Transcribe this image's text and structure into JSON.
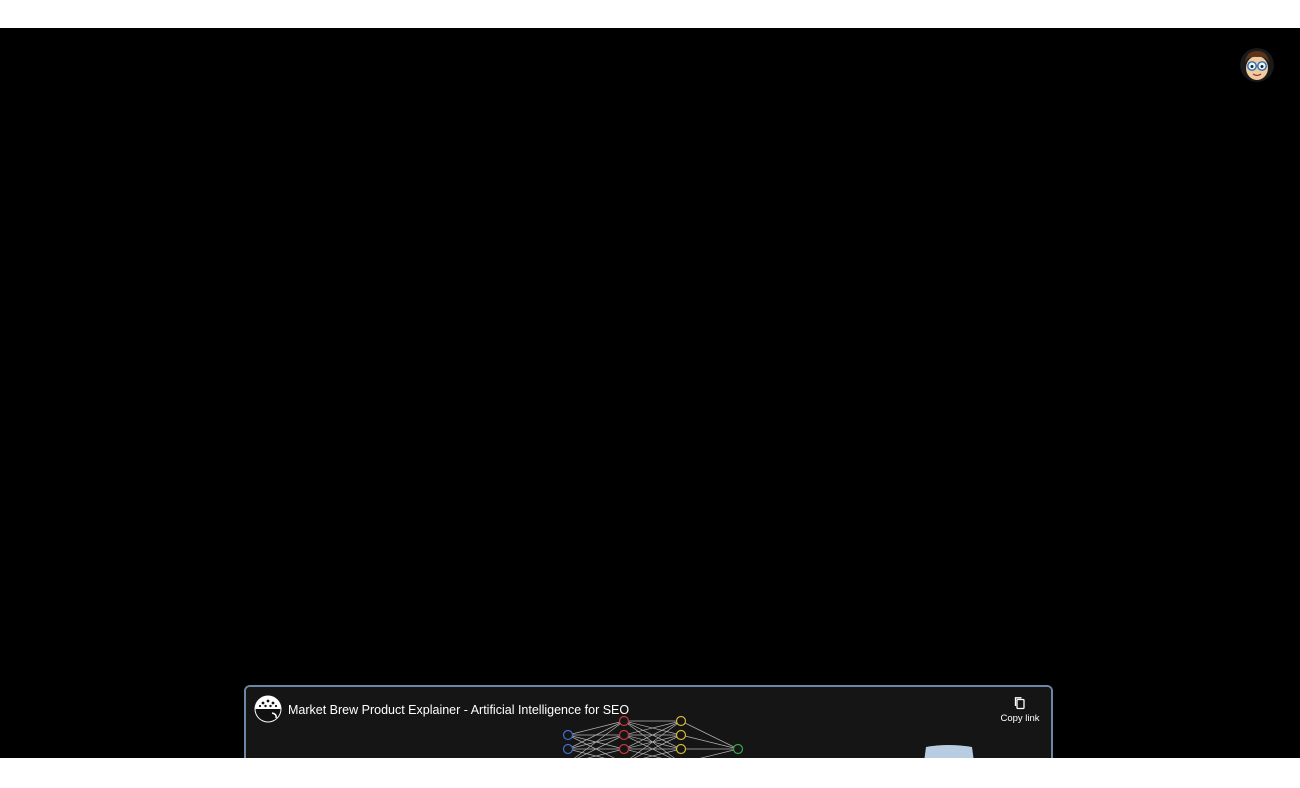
{
  "player": {
    "background": "#000000",
    "avatar_icon": "cartoon-face-with-glasses-icon"
  },
  "embed": {
    "channel_logo_icon": "market-brew-logo-icon",
    "title": "Market Brew Product Explainer - Artificial Intelligence for SEO",
    "copy_link_label": "Copy link",
    "copy_link_icon": "copy-icon",
    "thumbnail_icon": "neural-network-diagram-icon",
    "border_color": "#6e86a6"
  }
}
